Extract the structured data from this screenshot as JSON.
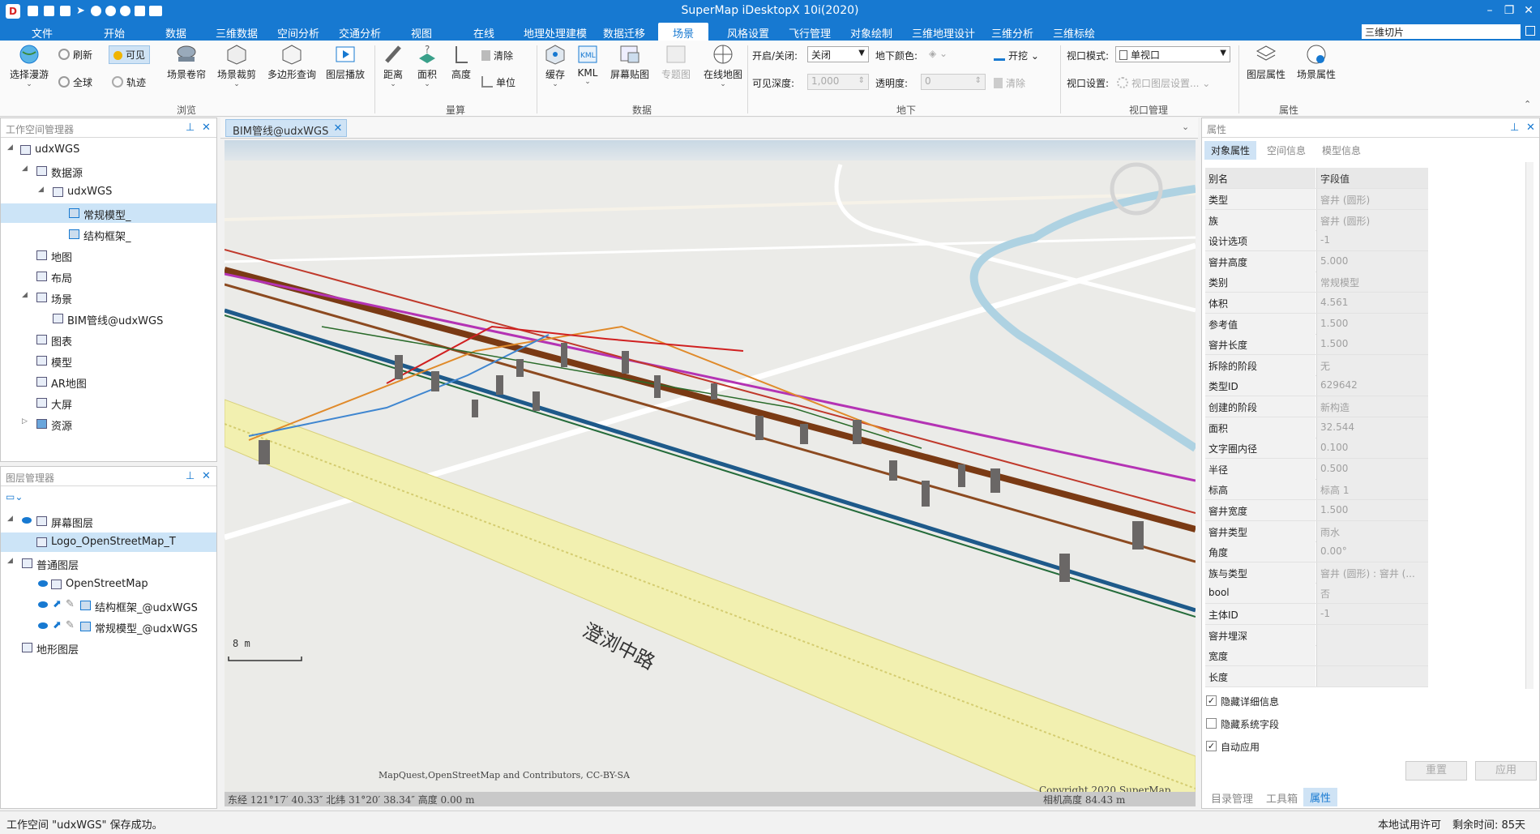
{
  "app": {
    "title": "SuperMap iDesktopX 10i(2020)"
  },
  "menu": {
    "file": "文件",
    "start": "开始",
    "data": "数据",
    "data3d": "三维数据",
    "spatial": "空间分析",
    "traffic": "交通分析",
    "view": "视图",
    "online": "在线",
    "gp": "地理处理建模",
    "migrate": "数据迁移",
    "scene": "场景",
    "style": "风格设置",
    "flight": "飞行管理",
    "draw": "对象绘制",
    "geo3d": "三维地理设计",
    "analysis3d": "三维分析",
    "mark3d": "三维标绘",
    "search_value": "三维切片"
  },
  "ribbon": {
    "select_roam": "选择漫游",
    "refresh": "刷新",
    "visible": "可见",
    "full_extent": "全球",
    "track": "轨迹",
    "scene_shutter": "场景卷帘",
    "scene_clip": "场景裁剪",
    "polygon_query": "多边形查询",
    "layer_play": "图层播放",
    "browse_group": "浏览",
    "distance": "距离",
    "area": "面积",
    "height": "高度",
    "clear": "清除",
    "unit": "单位",
    "measure_group": "量算",
    "buffer": "缓存",
    "kml": "KML",
    "screen_map": "屏幕贴图",
    "thematic": "专题图",
    "online_map": "在线地图",
    "data_group": "数据",
    "toggle_label": "开启/关闭:",
    "toggle_value": "关闭",
    "underground_color_label": "地下颜色:",
    "dig": "开挖",
    "visible_depth_label": "可见深度:",
    "visible_depth_value": "1,000",
    "transparency_label": "透明度:",
    "transparency_value": "0",
    "clear2": "清除",
    "underground_group": "地下",
    "viewport_mode_label": "视口模式:",
    "viewport_mode_value": "单视口",
    "viewport_settings_label": "视口设置:",
    "viewport_layer_settings": "视口图层设置...",
    "viewport_group": "视口管理",
    "layer_props": "图层属性",
    "scene_props": "场景属性",
    "props_group": "属性"
  },
  "workspace": {
    "title": "工作空间管理器",
    "items": [
      {
        "label": "udxWGS"
      },
      {
        "label": "数据源"
      },
      {
        "label": "udxWGS"
      },
      {
        "label": "常规模型_"
      },
      {
        "label": "结构框架_"
      },
      {
        "label": "地图"
      },
      {
        "label": "布局"
      },
      {
        "label": "场景"
      },
      {
        "label": "BIM管线@udxWGS"
      },
      {
        "label": "图表"
      },
      {
        "label": "模型"
      },
      {
        "label": "AR地图"
      },
      {
        "label": "大屏"
      },
      {
        "label": "资源"
      }
    ]
  },
  "layers": {
    "title": "图层管理器",
    "items": [
      {
        "label": "屏幕图层"
      },
      {
        "label": "Logo_OpenStreetMap_T"
      },
      {
        "label": "普通图层"
      },
      {
        "label": "OpenStreetMap"
      },
      {
        "label": "结构框架_@udxWGS"
      },
      {
        "label": "常规模型_@udxWGS"
      },
      {
        "label": "地形图层"
      }
    ]
  },
  "doc_tab": {
    "label": "BIM管线@udxWGS"
  },
  "scene": {
    "road_label": "澄浏中路",
    "scale_label": "8 m",
    "attribution": "MapQuest,OpenStreetMap and Contributors, CC-BY-SA",
    "copyright": "Copyright 2020 SuperMap",
    "coords": "东经 121°17′ 40.33″   北纬 31°20′ 38.34″   高度 0.00 m",
    "camera_height": "相机高度 84.43 m"
  },
  "properties": {
    "title": "属性",
    "tabs": [
      "对象属性",
      "空间信息",
      "模型信息"
    ],
    "header": {
      "key": "别名",
      "value": "字段值"
    },
    "rows": [
      {
        "k": "类型",
        "v": "窨井 (圆形)"
      },
      {
        "k": "族",
        "v": "窨井 (圆形)"
      },
      {
        "k": "设计选项",
        "v": "-1"
      },
      {
        "k": "窨井高度",
        "v": "5.000"
      },
      {
        "k": "类别",
        "v": "常规模型"
      },
      {
        "k": "体积",
        "v": "4.561"
      },
      {
        "k": "参考值",
        "v": "1.500"
      },
      {
        "k": "窨井长度",
        "v": "1.500"
      },
      {
        "k": "拆除的阶段",
        "v": "无"
      },
      {
        "k": "类型ID",
        "v": "629642"
      },
      {
        "k": "创建的阶段",
        "v": "新构造"
      },
      {
        "k": "面积",
        "v": "32.544"
      },
      {
        "k": "文字圈内径",
        "v": "0.100"
      },
      {
        "k": "半径",
        "v": "0.500"
      },
      {
        "k": "标高",
        "v": "标高 1"
      },
      {
        "k": "窨井宽度",
        "v": "1.500"
      },
      {
        "k": "窨井类型",
        "v": "雨水"
      },
      {
        "k": "角度",
        "v": "0.00°"
      },
      {
        "k": "族与类型",
        "v": "窨井 (圆形) : 窨井 (..."
      },
      {
        "k": "bool",
        "v": "否"
      },
      {
        "k": "主体ID",
        "v": "-1"
      },
      {
        "k": "窨井埋深",
        "v": ""
      },
      {
        "k": "宽度",
        "v": ""
      },
      {
        "k": "长度",
        "v": ""
      }
    ],
    "hide_detail": "隐藏详细信息",
    "hide_system": "隐藏系统字段",
    "auto_apply": "自动应用",
    "reset": "重置",
    "apply": "应用",
    "bottom_tabs": [
      "目录管理",
      "工具箱",
      "属性"
    ]
  },
  "status": {
    "message": "工作空间 \"udxWGS\" 保存成功。",
    "license": "本地试用许可",
    "remaining": "剩余时间: 85天"
  }
}
